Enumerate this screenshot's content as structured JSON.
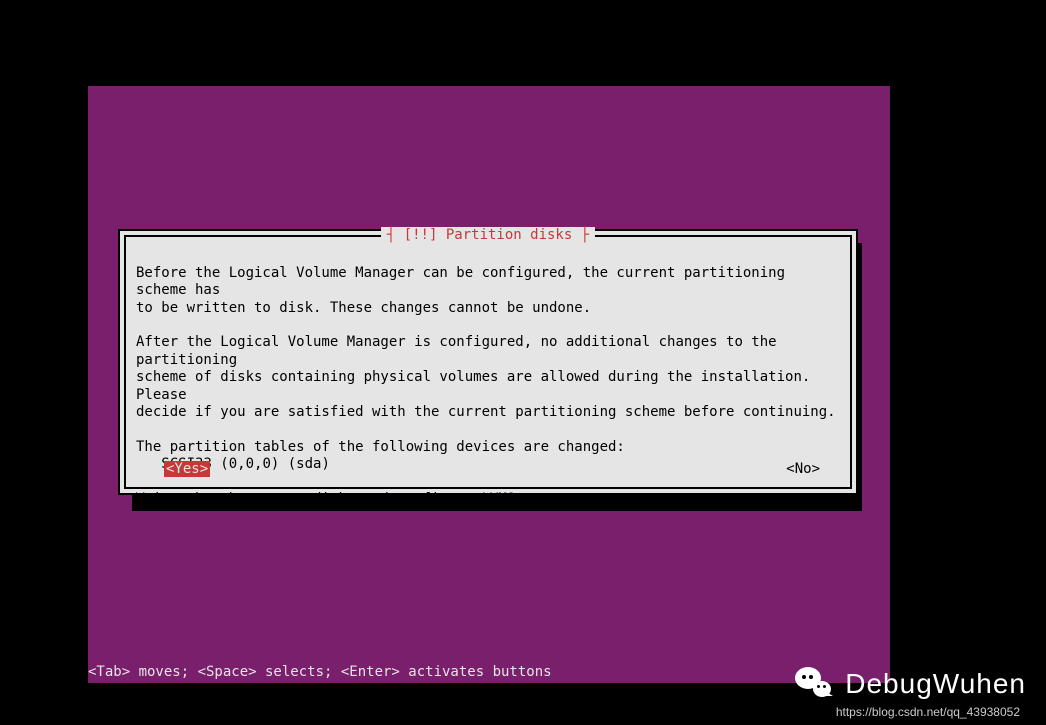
{
  "dialog": {
    "title_prefix": "┤ ",
    "title_icon": "[!!]",
    "title_text": " Partition disks",
    "title_suffix": " ├",
    "paragraph1": "Before the Logical Volume Manager can be configured, the current partitioning scheme has\nto be written to disk. These changes cannot be undone.",
    "paragraph2": "After the Logical Volume Manager is configured, no additional changes to the partitioning\nscheme of disks containing physical volumes are allowed during the installation. Please\ndecide if you are satisfied with the current partitioning scheme before continuing.",
    "devices_intro": "The partition tables of the following devices are changed:",
    "devices": "   SCSI33 (0,0,0) (sda)",
    "prompt": "Write the changes to disks and configure LVM?",
    "yes": "<Yes>",
    "no": "<No>"
  },
  "hint": "<Tab> moves; <Space> selects; <Enter> activates buttons",
  "watermark": {
    "name": "DebugWuhen",
    "url": "https://blog.csdn.net/qq_43938052"
  },
  "colors": {
    "background": "#000000",
    "installer_bg": "#7a1f6c",
    "dialog_bg": "#e5e5e5",
    "accent": "#c83737"
  }
}
